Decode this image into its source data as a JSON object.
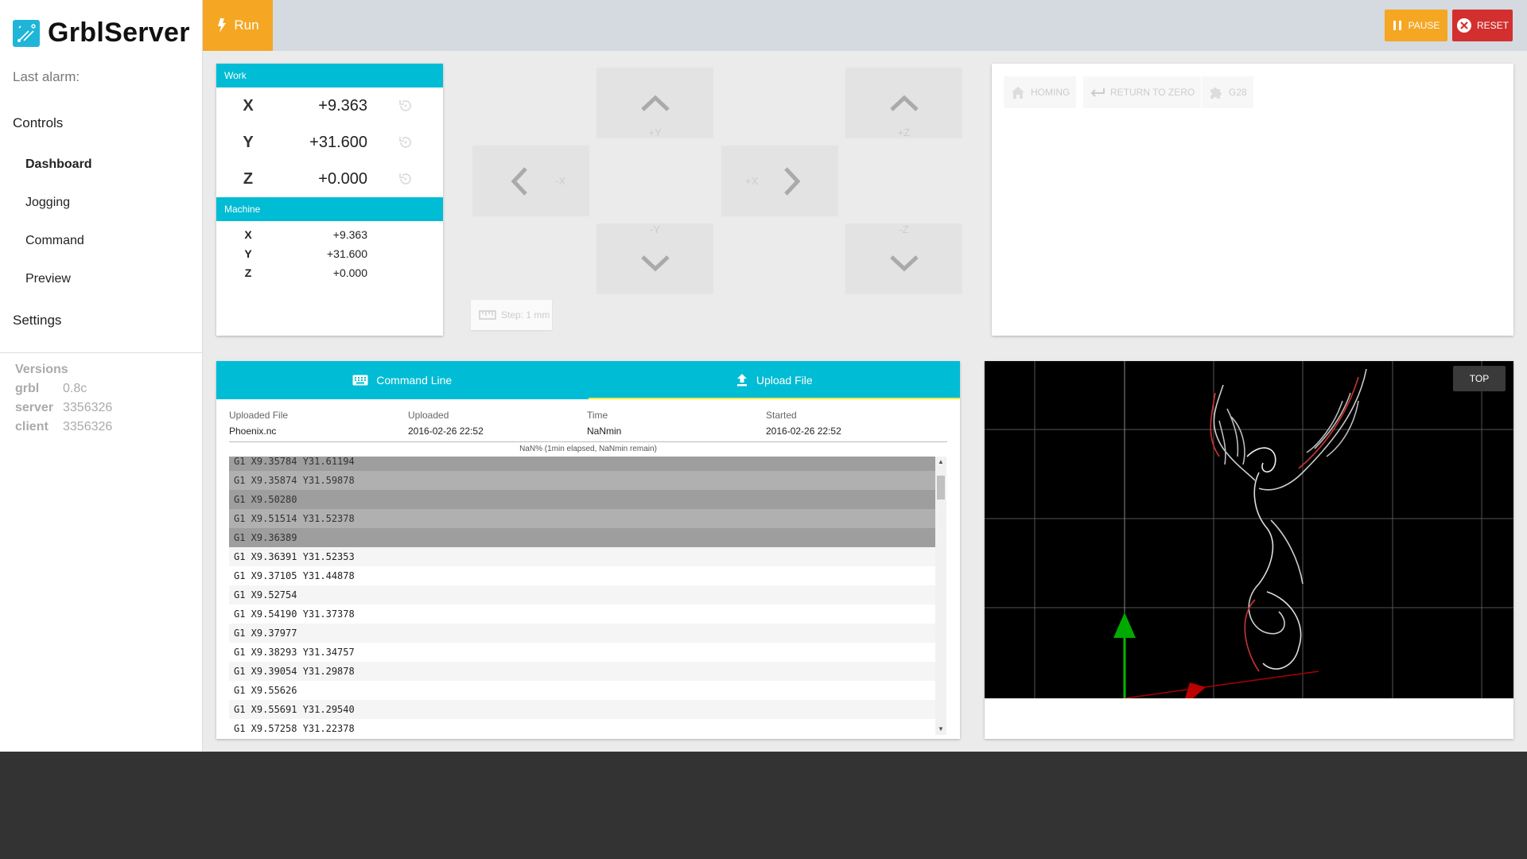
{
  "app": {
    "title": "GrblServer",
    "last_alarm_label": "Last alarm:",
    "accent": "#00bcd4",
    "run_color": "#f5a623",
    "reset_color": "#d32f2f"
  },
  "sidebar": {
    "sections": {
      "controls": "Controls",
      "settings": "Settings"
    },
    "items": [
      {
        "label": "Dashboard",
        "active": true
      },
      {
        "label": "Jogging",
        "active": false
      },
      {
        "label": "Command",
        "active": false
      },
      {
        "label": "Preview",
        "active": false
      }
    ],
    "versions": {
      "title": "Versions",
      "rows": [
        {
          "key": "grbl",
          "value": "0.8c"
        },
        {
          "key": "server",
          "value": "3356326"
        },
        {
          "key": "client",
          "value": "3356326"
        }
      ]
    }
  },
  "toolbar": {
    "run_label": "Run",
    "pause_label": "PAUSE",
    "reset_label": "RESET"
  },
  "position": {
    "work_title": "Work",
    "machine_title": "Machine",
    "work": [
      {
        "axis": "X",
        "value": "+9.363"
      },
      {
        "axis": "Y",
        "value": "+31.600"
      },
      {
        "axis": "Z",
        "value": "+0.000"
      }
    ],
    "machine": [
      {
        "axis": "X",
        "value": "+9.363"
      },
      {
        "axis": "Y",
        "value": "+31.600"
      },
      {
        "axis": "Z",
        "value": "+0.000"
      }
    ]
  },
  "jog": {
    "plus_y": "+Y",
    "minus_y": "-Y",
    "minus_x": "-X",
    "plus_x": "+X",
    "plus_z": "+Z",
    "minus_z": "-Z",
    "step_label": "Step: 1 mm"
  },
  "actions": {
    "homing": "HOMING",
    "return_to_zero": "RETURN TO ZERO",
    "g28": "G28"
  },
  "file_panel": {
    "tabs": [
      {
        "label": "Command Line",
        "active": false
      },
      {
        "label": "Upload File",
        "active": true
      }
    ],
    "headers": [
      "Uploaded File",
      "Uploaded",
      "Time",
      "Started"
    ],
    "values": [
      "Phoenix.nc",
      "2016-02-26 22:52",
      "NaNmin",
      "2016-02-26 22:52"
    ],
    "progress_text": "NaN% (1min elapsed, NaNmin remain)",
    "gcode_lines": [
      {
        "text": "G1 X9.35784 Y31.61194",
        "done": true
      },
      {
        "text": "G1 X9.35874 Y31.59878",
        "done": true
      },
      {
        "text": "G1 X9.50280",
        "done": true
      },
      {
        "text": "G1 X9.51514 Y31.52378",
        "done": true
      },
      {
        "text": "G1 X9.36389",
        "done": true
      },
      {
        "text": "G1 X9.36391 Y31.52353",
        "done": false
      },
      {
        "text": "G1 X9.37105 Y31.44878",
        "done": false
      },
      {
        "text": "G1 X9.52754",
        "done": false
      },
      {
        "text": "G1 X9.54190 Y31.37378",
        "done": false
      },
      {
        "text": "G1 X9.37977",
        "done": false
      },
      {
        "text": "G1 X9.38293 Y31.34757",
        "done": false
      },
      {
        "text": "G1 X9.39054 Y31.29878",
        "done": false
      },
      {
        "text": "G1 X9.55626",
        "done": false
      },
      {
        "text": "G1 X9.55691 Y31.29540",
        "done": false
      },
      {
        "text": "G1 X9.57258 Y31.22378",
        "done": false
      }
    ]
  },
  "viewer": {
    "view_button": "TOP"
  }
}
